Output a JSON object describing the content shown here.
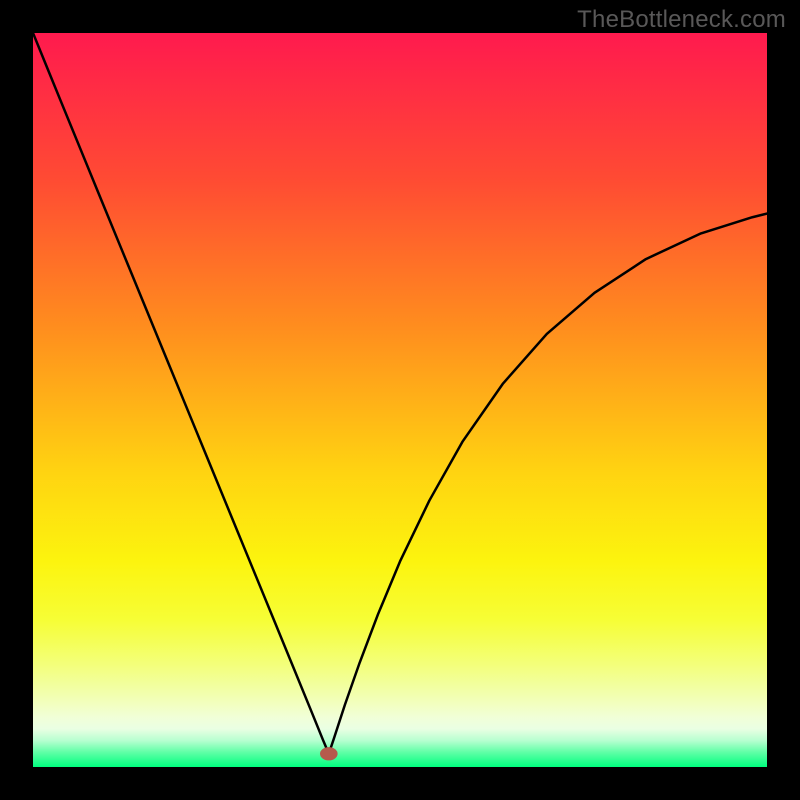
{
  "watermark": "TheBottleneck.com",
  "chart_data": {
    "type": "line",
    "title": "",
    "xlabel": "",
    "ylabel": "",
    "xlim": [
      0.0,
      1.0
    ],
    "ylim": [
      0.0,
      1.0
    ],
    "grid": false,
    "annotations": [],
    "background": {
      "gradient_stops": [
        {
          "y": 1.0,
          "color": "#ff1a4e"
        },
        {
          "y": 0.8,
          "color": "#ff4b33"
        },
        {
          "y": 0.6,
          "color": "#ff8d1e"
        },
        {
          "y": 0.4,
          "color": "#ffd411"
        },
        {
          "y": 0.28,
          "color": "#fcf40e"
        },
        {
          "y": 0.2,
          "color": "#f6fe36"
        },
        {
          "y": 0.14,
          "color": "#f3ff7a"
        },
        {
          "y": 0.096,
          "color": "#f2ffb2"
        },
        {
          "y": 0.068,
          "color": "#f1ffd7"
        },
        {
          "y": 0.052,
          "color": "#eaffe3"
        },
        {
          "y": 0.036,
          "color": "#b7ffd0"
        },
        {
          "y": 0.02,
          "color": "#5fffa6"
        },
        {
          "y": 0.0,
          "color": "#00ff7f"
        }
      ]
    },
    "series": [
      {
        "name": "bottleneck-curve",
        "type": "line",
        "color": "#000000",
        "stroke_width": 2.5,
        "x": [
          0.0,
          0.02,
          0.04,
          0.065,
          0.09,
          0.12,
          0.15,
          0.18,
          0.21,
          0.24,
          0.27,
          0.3,
          0.33,
          0.355,
          0.38,
          0.395,
          0.403,
          0.41,
          0.425,
          0.445,
          0.47,
          0.5,
          0.54,
          0.585,
          0.64,
          0.7,
          0.765,
          0.835,
          0.91,
          0.98,
          1.0
        ],
        "y": [
          1.0,
          0.951,
          0.902,
          0.841,
          0.78,
          0.707,
          0.634,
          0.561,
          0.488,
          0.415,
          0.342,
          0.269,
          0.196,
          0.135,
          0.074,
          0.037,
          0.018,
          0.039,
          0.085,
          0.142,
          0.208,
          0.28,
          0.363,
          0.443,
          0.522,
          0.59,
          0.646,
          0.692,
          0.727,
          0.749,
          0.754
        ]
      }
    ],
    "marker": {
      "name": "minimum-marker",
      "x": 0.403,
      "y": 0.018,
      "rx": 0.012,
      "ry": 0.009,
      "fill": "#b65a4c"
    }
  }
}
